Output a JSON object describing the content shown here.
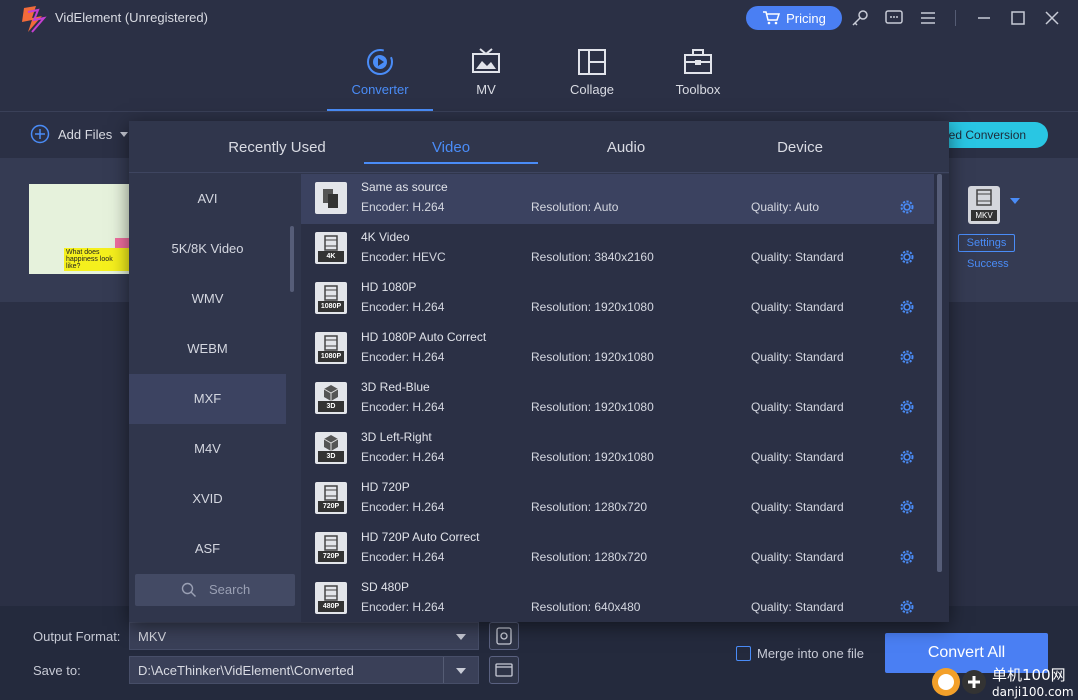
{
  "app": {
    "title": "VidElement (Unregistered)",
    "pricing_label": "Pricing"
  },
  "nav": [
    {
      "label": "Converter",
      "icon": "converter-icon",
      "active": true
    },
    {
      "label": "MV",
      "icon": "tv-icon",
      "active": false
    },
    {
      "label": "Collage",
      "icon": "collage-icon",
      "active": false
    },
    {
      "label": "Toolbox",
      "icon": "toolbox-icon",
      "active": false
    }
  ],
  "toolbar": {
    "add_files_label": "Add Files",
    "speed_label": "eed Conversion"
  },
  "file": {
    "thumb_caption": "What does happiness look like?",
    "format_tag": "MKV",
    "settings_label": "Settings",
    "status": "Success"
  },
  "panel": {
    "tabs": [
      {
        "label": "Recently Used",
        "active": false
      },
      {
        "label": "Video",
        "active": true
      },
      {
        "label": "Audio",
        "active": false
      },
      {
        "label": "Device",
        "active": false
      }
    ],
    "categories": [
      {
        "label": "AVI",
        "active": false
      },
      {
        "label": "5K/8K Video",
        "active": false
      },
      {
        "label": "WMV",
        "active": false
      },
      {
        "label": "WEBM",
        "active": false
      },
      {
        "label": "MXF",
        "active": true
      },
      {
        "label": "M4V",
        "active": false
      },
      {
        "label": "XVID",
        "active": false
      },
      {
        "label": "ASF",
        "active": false
      }
    ],
    "search_placeholder": "Search",
    "presets": [
      {
        "name": "Same as source",
        "encoder": "Encoder: H.264",
        "resolution": "Resolution: Auto",
        "quality": "Quality: Auto",
        "tag": "",
        "active": true
      },
      {
        "name": "4K Video",
        "encoder": "Encoder: HEVC",
        "resolution": "Resolution: 3840x2160",
        "quality": "Quality: Standard",
        "tag": "4K",
        "active": false
      },
      {
        "name": "HD 1080P",
        "encoder": "Encoder: H.264",
        "resolution": "Resolution: 1920x1080",
        "quality": "Quality: Standard",
        "tag": "1080P",
        "active": false
      },
      {
        "name": "HD 1080P Auto Correct",
        "encoder": "Encoder: H.264",
        "resolution": "Resolution: 1920x1080",
        "quality": "Quality: Standard",
        "tag": "1080P",
        "active": false
      },
      {
        "name": "3D Red-Blue",
        "encoder": "Encoder: H.264",
        "resolution": "Resolution: 1920x1080",
        "quality": "Quality: Standard",
        "tag": "3D",
        "active": false
      },
      {
        "name": "3D Left-Right",
        "encoder": "Encoder: H.264",
        "resolution": "Resolution: 1920x1080",
        "quality": "Quality: Standard",
        "tag": "3D",
        "active": false
      },
      {
        "name": "HD 720P",
        "encoder": "Encoder: H.264",
        "resolution": "Resolution: 1280x720",
        "quality": "Quality: Standard",
        "tag": "720P",
        "active": false
      },
      {
        "name": "HD 720P Auto Correct",
        "encoder": "Encoder: H.264",
        "resolution": "Resolution: 1280x720",
        "quality": "Quality: Standard",
        "tag": "720P",
        "active": false
      },
      {
        "name": "SD 480P",
        "encoder": "Encoder: H.264",
        "resolution": "Resolution: 640x480",
        "quality": "Quality: Standard",
        "tag": "480P",
        "active": false
      }
    ]
  },
  "bottom": {
    "output_format_label": "Output Format:",
    "output_format_value": "MKV",
    "save_to_label": "Save to:",
    "save_to_value": "D:\\AceThinker\\VidElement\\Converted",
    "merge_label": "Merge into one file",
    "convert_all_label": "Convert All"
  },
  "colors": {
    "accent": "#4a8cf7",
    "button": "#4a7ff3",
    "speed": "#29c6e3",
    "bg": "#2b3045"
  }
}
